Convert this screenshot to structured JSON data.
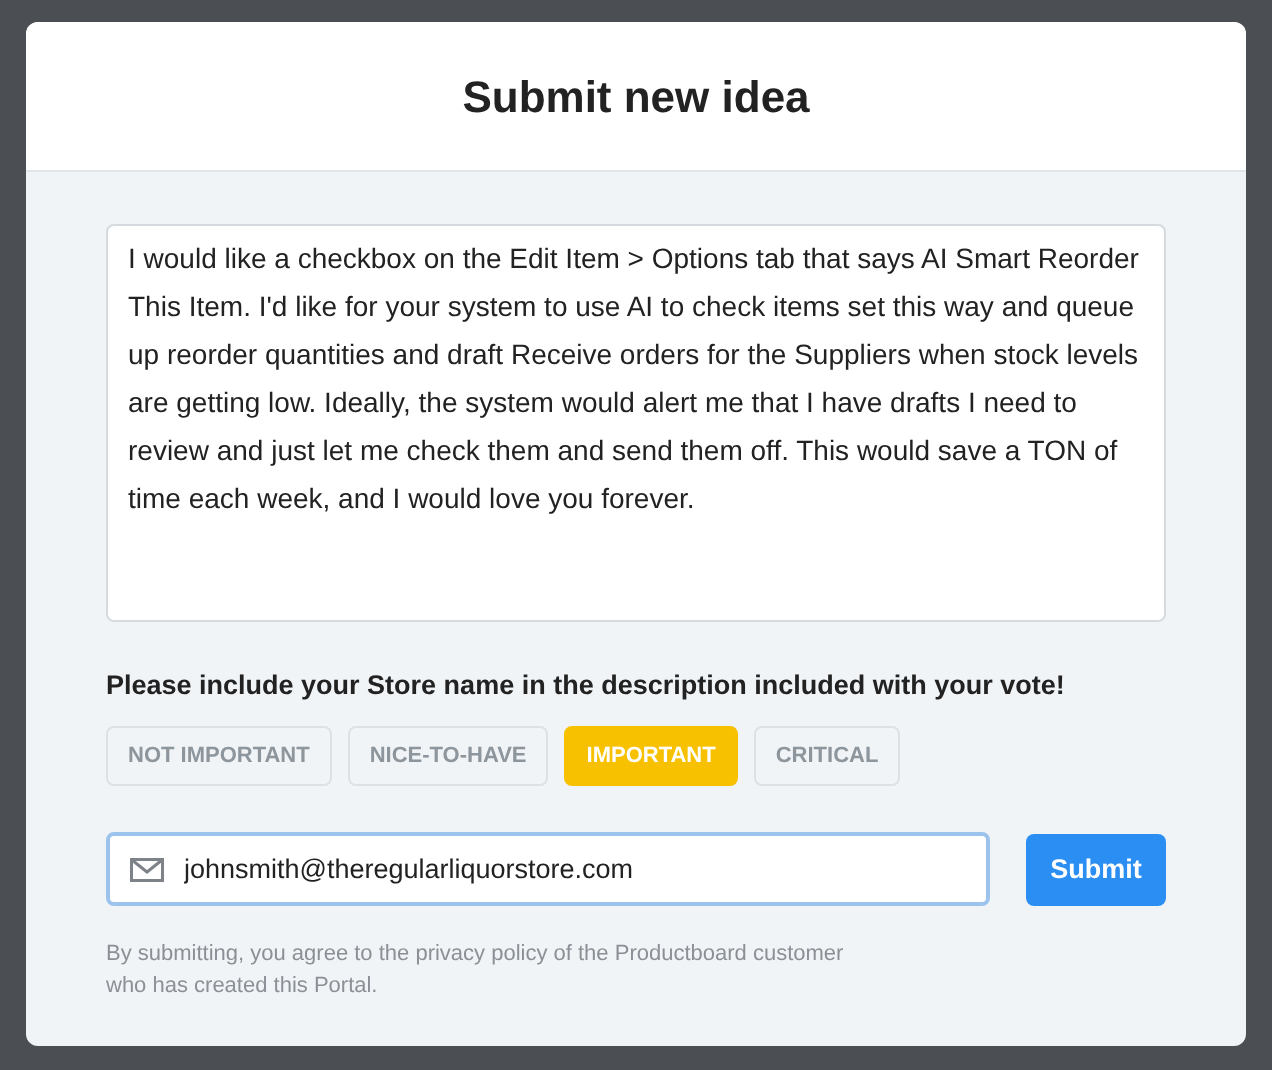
{
  "dialog": {
    "title": "Submit new idea"
  },
  "description": {
    "value": "I would like a checkbox on the Edit Item > Options tab that says AI Smart Reorder This Item. I'd like for your system to use AI to check items set this way and queue up reorder quantities and draft Receive orders for the Suppliers when stock levels are getting low. Ideally, the system would alert me that I have drafts I need to review and just let me check them and send them off. This would save a TON of time each week, and I would love you forever."
  },
  "importance": {
    "label": "Please include your Store name in the description included with your vote!",
    "options": [
      {
        "label": "NOT IMPORTANT",
        "selected": false
      },
      {
        "label": "NICE-TO-HAVE",
        "selected": false
      },
      {
        "label": "IMPORTANT",
        "selected": true
      },
      {
        "label": "CRITICAL",
        "selected": false
      }
    ]
  },
  "email": {
    "value": "johnsmith@theregularliquorstore.com"
  },
  "submit": "Submit",
  "disclaimer": "By submitting, you agree to the privacy policy of the Productboard customer who has created this Portal."
}
